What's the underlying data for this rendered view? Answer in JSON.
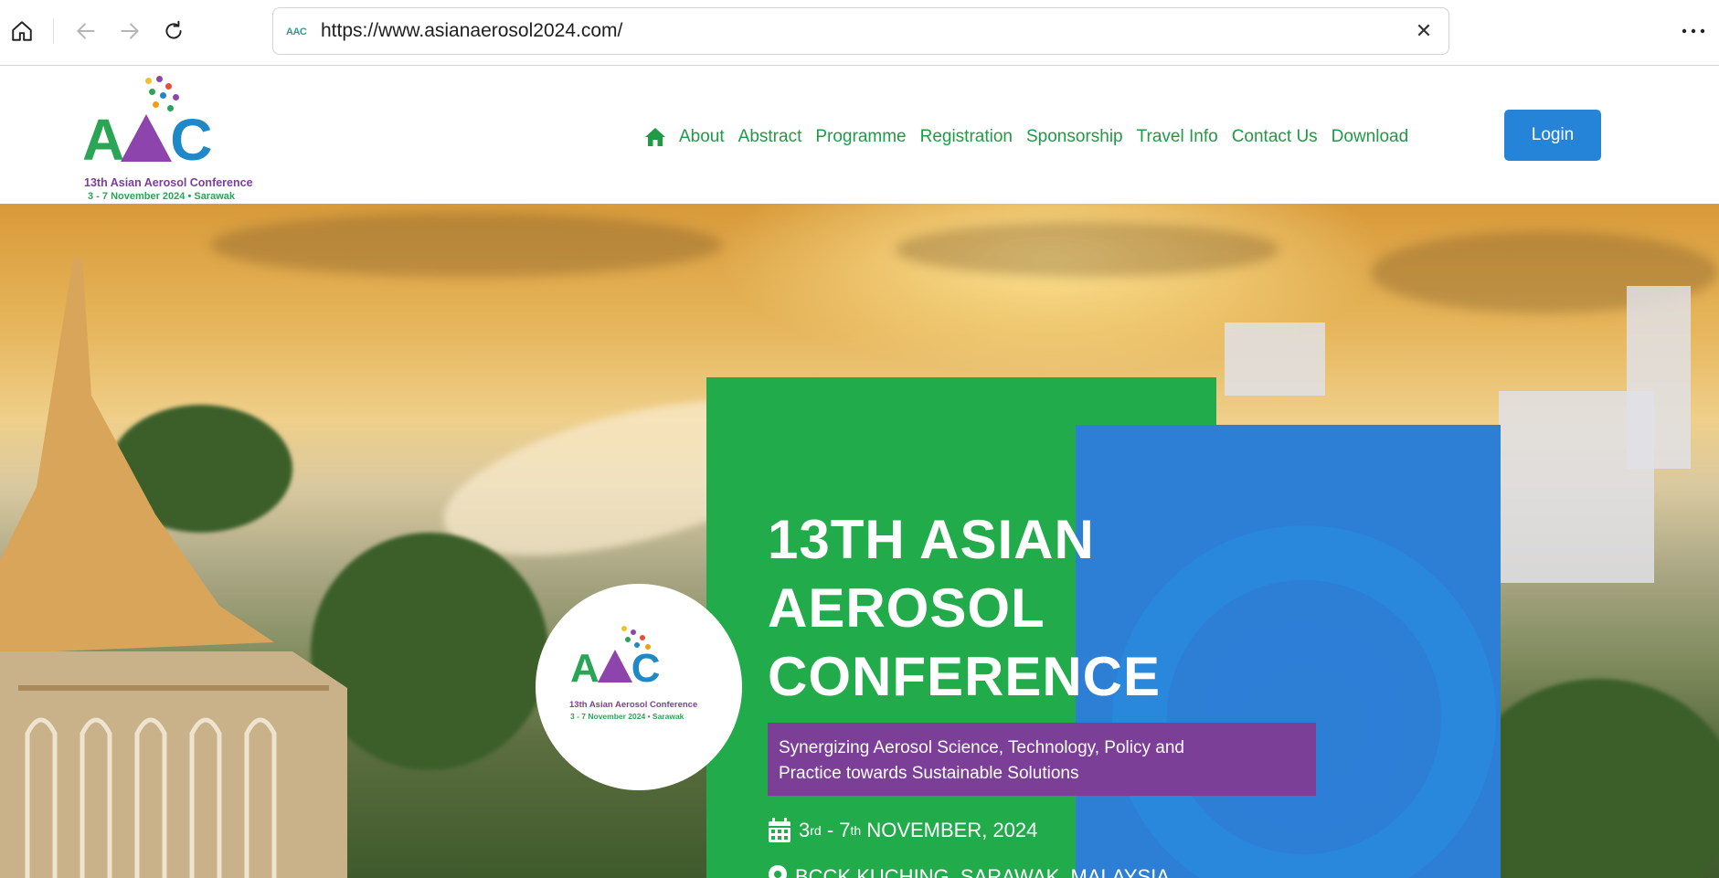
{
  "browser": {
    "url": "https://www.asianaerosol2024.com/",
    "favicon_text": "AAC",
    "clear_symbol": "✕"
  },
  "logo": {
    "letter_a": "A",
    "letter_c": "C",
    "line1": "13th Asian Aerosol Conference",
    "line2": "3 - 7 November 2024  •  Sarawak"
  },
  "nav": {
    "items": [
      "About",
      "Abstract",
      "Programme",
      "Registration",
      "Sponsorship",
      "Travel Info",
      "Contact Us",
      "Download"
    ],
    "login_label": "Login"
  },
  "hero": {
    "title_lines": [
      "13TH ASIAN",
      "AEROSOL",
      "CONFERENCE"
    ],
    "tagline_line1": "Synergizing Aerosol Science, Technology, Policy and",
    "tagline_line2": "Practice towards Sustainable Solutions",
    "date": {
      "start_day": "3",
      "start_suffix": "rd",
      "separator": " - ",
      "end_day": "7",
      "end_suffix": "th",
      "month_year": " NOVEMBER, 2024"
    },
    "venue": "BCCK KUCHING, SARAWAK, MALAYSIA"
  },
  "colors": {
    "brand_green": "#22ab4a",
    "brand_blue": "#2c7fd4",
    "brand_purple": "#7b3f98",
    "login_blue": "#2684d8",
    "nav_text": "#1f9b45"
  },
  "icons": {
    "home": "home-icon",
    "back": "arrow-left-icon",
    "forward": "arrow-right-icon",
    "reload": "reload-icon",
    "more": "more-horizontal-icon",
    "calendar": "calendar-icon",
    "location": "map-pin-icon"
  }
}
